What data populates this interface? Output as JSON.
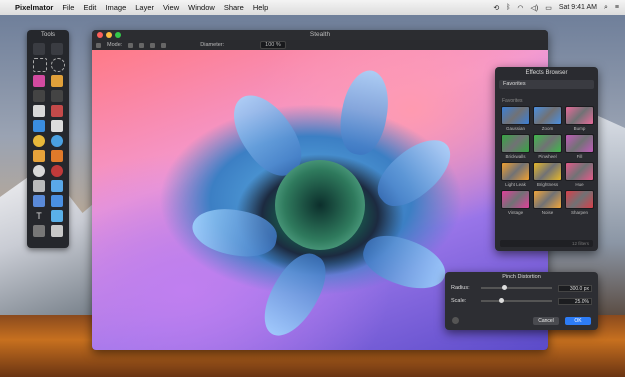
{
  "menubar": {
    "apple_icon": "apple-icon",
    "app_name": "Pixelmator",
    "menus": [
      "File",
      "Edit",
      "Image",
      "Layer",
      "View",
      "Window",
      "Share",
      "Help"
    ],
    "clock": "Sat 9:41 AM"
  },
  "tools_panel": {
    "title": "Tools"
  },
  "document": {
    "title": "Stealth",
    "mode_label": "Mode:",
    "diameter_label": "Diameter:",
    "zoom": "100 %"
  },
  "effects_browser": {
    "title": "Effects Browser",
    "category": "Favorites",
    "section": "Favorites",
    "effects": [
      {
        "label": "Gaussian",
        "color": "#3b7fd6"
      },
      {
        "label": "Zoom",
        "color": "#4a8fe0"
      },
      {
        "label": "Bump",
        "color": "#e86a9a"
      },
      {
        "label": "Brickwalls",
        "color": "#35a642"
      },
      {
        "label": "Pinwheel",
        "color": "#3fb84a"
      },
      {
        "label": "Fill",
        "color": "#c05ab8"
      },
      {
        "label": "Light Leak",
        "color": "#f0a030"
      },
      {
        "label": "Brightness",
        "color": "#e6b82a"
      },
      {
        "label": "Hue",
        "color": "#e35a8a"
      },
      {
        "label": "Vintage",
        "color": "#e0409a"
      },
      {
        "label": "Noise",
        "color": "#f2a63a"
      },
      {
        "label": "Sharpen",
        "color": "#d8404a"
      }
    ],
    "count": "12 filters"
  },
  "pinch_distortion": {
    "title": "Pinch Distortion",
    "radius_label": "Radius:",
    "radius_value": "300.0 px",
    "radius_fraction": 0.3,
    "scale_label": "Scale:",
    "scale_value": "25.0%",
    "scale_fraction": 0.25,
    "cancel": "Cancel",
    "ok": "OK"
  },
  "colors": {
    "accent": "#2d7cf6",
    "close": "#fc605b",
    "minimize": "#fdbc40",
    "zoom": "#34c84a"
  }
}
